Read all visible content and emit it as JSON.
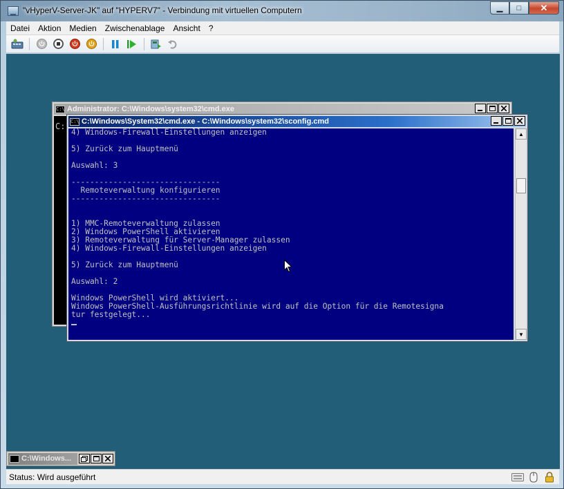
{
  "window": {
    "title": "\"vHyperV-Server-JK\" auf \"HYPERV7\" - Verbindung mit virtuellen Computern",
    "minimize": "▁",
    "maximize": "□",
    "close": "✕"
  },
  "menubar": {
    "items": [
      "Datei",
      "Aktion",
      "Medien",
      "Zwischenablage",
      "Ansicht",
      "?"
    ]
  },
  "toolbar": {
    "icons": [
      "ctrl-alt-del-icon",
      "start-icon",
      "turn-off-icon",
      "shutdown-icon",
      "save-state-icon",
      "pause-icon",
      "reset-icon",
      "snapshot-icon",
      "revert-icon"
    ]
  },
  "console_back": {
    "title": "Administrator: C:\\Windows\\system32\\cmd.exe",
    "icon_text": "C:\\",
    "visible_text": "C:"
  },
  "console_front": {
    "title": "C:\\Windows\\System32\\cmd.exe - C:\\Windows\\system32\\sconfig.cmd",
    "icon_text": "C:\\",
    "lines": [
      "4) Windows-Firewall-Einstellungen anzeigen",
      "",
      "5) Zurück zum Hauptmenü",
      "",
      "Auswahl: 3",
      "",
      "--------------------------------",
      "  Remoteverwaltung konfigurieren",
      "--------------------------------",
      "",
      "",
      "1) MMC-Remoteverwaltung zulassen",
      "2) Windows PowerShell aktivieren",
      "3) Remoteverwaltung für Server-Manager zulassen",
      "4) Windows-Firewall-Einstellungen anzeigen",
      "",
      "5) Zurück zum Hauptmenü",
      "",
      "Auswahl: 2",
      "",
      "Windows PowerShell wird aktiviert...",
      "Windows PowerShell-Ausführungsrichtlinie wird auf die Option für die Remotesigna",
      "tur festgelegt...",
      ""
    ]
  },
  "minimized_window": {
    "title": "C:\\Windows..."
  },
  "statusbar": {
    "text": "Status: Wird ausgeführt"
  },
  "colors": {
    "desktop": "#235e78",
    "console_bg": "#000080",
    "console_text": "#c0c0c0"
  }
}
